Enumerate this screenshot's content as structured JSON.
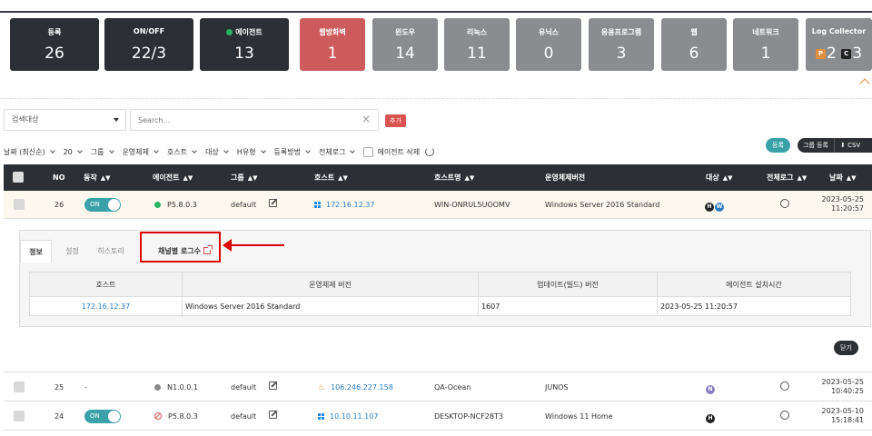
{
  "cards": [
    {
      "label": "등록",
      "value": "26"
    },
    {
      "label": "ON/OFF",
      "value": "22/3"
    },
    {
      "label": "에이전트",
      "value": "13"
    },
    {
      "label": "웹방화벽",
      "value": "1"
    },
    {
      "label": "윈도우",
      "value": "14"
    },
    {
      "label": "리눅스",
      "value": "11"
    },
    {
      "label": "유닉스",
      "value": "0"
    },
    {
      "label": "응용프로그램",
      "value": "3"
    },
    {
      "label": "웹",
      "value": "6"
    },
    {
      "label": "네트워크",
      "value": "1"
    },
    {
      "label": "Log Collector",
      "p_label": "P",
      "p_value": "2",
      "c_label": "C",
      "c_value": "3"
    }
  ],
  "search": {
    "target_label": "검색대상",
    "placeholder": "Search...",
    "add_label": "추가"
  },
  "filters": {
    "items": [
      "날짜 (최신순)",
      "20",
      "그룹",
      "운영체제",
      "호스트",
      "대상",
      "H유형",
      "등록방법",
      "전체로그"
    ],
    "delete_agent_label": "에이전트 삭제"
  },
  "actions": {
    "register": "등록",
    "group_register": "그룹 등록",
    "csv": "⬇ CSV"
  },
  "table": {
    "headers": {
      "no": "NO",
      "action": "동작",
      "agent": "에이전트",
      "group": "그룹",
      "host": "호스트",
      "hostname": "호스트명",
      "os": "운영체제버전",
      "target": "대상",
      "all_log": "전체로그",
      "date": "날짜"
    },
    "rows": [
      {
        "no": "26",
        "toggle": "ON",
        "agent": "P5.8.0.3",
        "group": "default",
        "host": "172.16.12.37",
        "hostname": "WIN-ONRUL5UOOMV",
        "os": "Windows Server 2016 Standard",
        "date1": "2023-05-25",
        "date2": "11:20:57"
      },
      {
        "no": "25",
        "toggle": "-",
        "agent": "N1.0.0.1",
        "group": "default",
        "host": "106.246.227.158",
        "hostname": "QA-Ocean",
        "os": "JUNOS",
        "date1": "2023-05-25",
        "date2": "10:40:25"
      },
      {
        "no": "24",
        "toggle": "ON",
        "agent": "P5.8.0.3",
        "group": "default",
        "host": "10.10.11.107",
        "hostname": "DESKTOP-NCF28T3",
        "os": "Windows 11 Home",
        "date1": "2023-05-10",
        "date2": "15:18:41"
      }
    ]
  },
  "detail": {
    "tabs": [
      "정보",
      "설정",
      "히스토리"
    ],
    "channel_log": "채널별 로그수",
    "columns": [
      "호스트",
      "운영체제 버전",
      "업데이트(빌드) 버전",
      "에이전트 설치시간"
    ],
    "values": [
      "172.16.12.37",
      "Windows Server 2016 Standard",
      "1607",
      "2023-05-25 11:20:57"
    ],
    "close_label": "닫기"
  },
  "target_badges": {
    "h": "H",
    "w": "W",
    "n": "N"
  },
  "colors": {
    "dark": "#2c2f34",
    "accent": "#3aa1a8",
    "red": "#cd5b5b",
    "gray": "#8a8c90",
    "link": "#2a7dc4"
  }
}
